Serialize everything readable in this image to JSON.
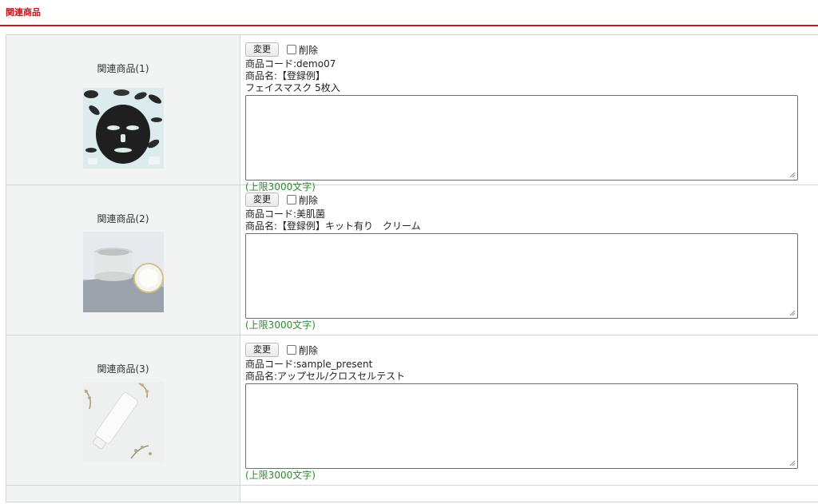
{
  "section": {
    "title": "関連商品"
  },
  "rows": [
    {
      "label": "関連商品(1)",
      "change_label": "変更",
      "delete_label": "削除",
      "code_line": "商品コード:demo07",
      "name_line": "商品名:【登録例】",
      "name_line2": "フェイスマスク 5枚入",
      "limit_text": "(上限3000文字)"
    },
    {
      "label": "関連商品(2)",
      "change_label": "変更",
      "delete_label": "削除",
      "code_line": "商品コード:美肌菌",
      "name_line": "商品名:【登録例】キット有り　クリーム",
      "limit_text": "(上限3000文字)"
    },
    {
      "label": "関連商品(3)",
      "change_label": "変更",
      "delete_label": "削除",
      "code_line": "商品コード:sample_present",
      "name_line": "商品名:アップセル/クロスセルテスト",
      "limit_text": "(上限3000文字)"
    }
  ]
}
